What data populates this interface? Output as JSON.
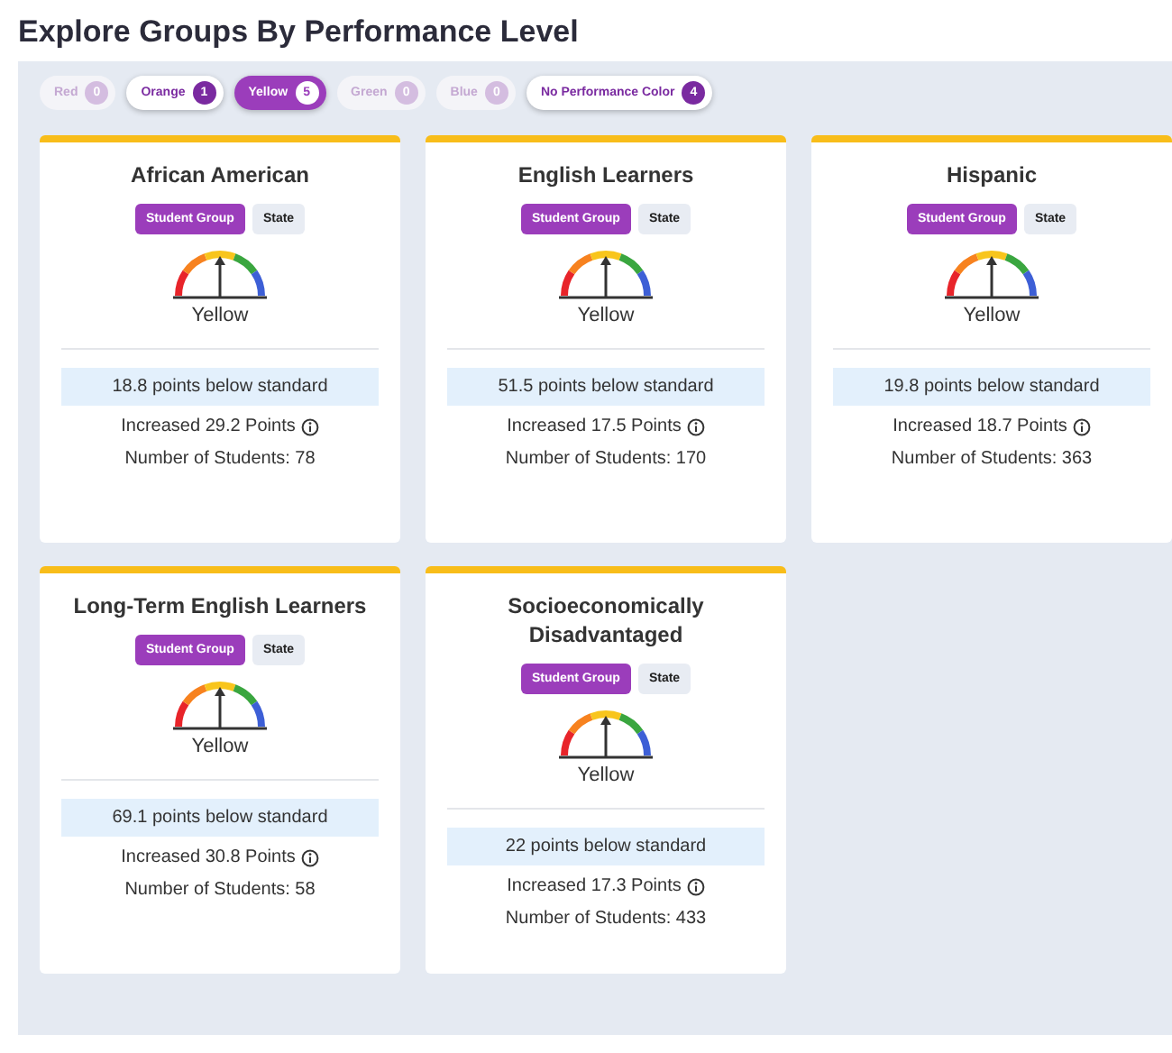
{
  "title": "Explore Groups By Performance Level",
  "filters": [
    {
      "label": "Red",
      "count": "0",
      "selected": false,
      "disabled": true
    },
    {
      "label": "Orange",
      "count": "1",
      "selected": false,
      "disabled": false
    },
    {
      "label": "Yellow",
      "count": "5",
      "selected": true,
      "disabled": false
    },
    {
      "label": "Green",
      "count": "0",
      "selected": false,
      "disabled": true
    },
    {
      "label": "Blue",
      "count": "0",
      "selected": false,
      "disabled": true
    },
    {
      "label": "No Performance Color",
      "count": "4",
      "selected": false,
      "disabled": false
    }
  ],
  "cards": [
    {
      "name": "African American",
      "tabs": [
        {
          "label": "Student Group",
          "selected": true
        },
        {
          "label": "State",
          "selected": false
        }
      ],
      "level_label": "Yellow",
      "status": "18.8 points below standard",
      "change": "Increased 29.2 Points",
      "students": "Number of Students: 78"
    },
    {
      "name": "English Learners",
      "tabs": [
        {
          "label": "Student Group",
          "selected": true
        },
        {
          "label": "State",
          "selected": false
        }
      ],
      "level_label": "Yellow",
      "status": "51.5 points below standard",
      "change": "Increased 17.5 Points",
      "students": "Number of Students: 170"
    },
    {
      "name": "Hispanic",
      "tabs": [
        {
          "label": "Student Group",
          "selected": true
        },
        {
          "label": "State",
          "selected": false
        }
      ],
      "level_label": "Yellow",
      "status": "19.8 points below standard",
      "change": "Increased 18.7 Points",
      "students": "Number of Students: 363"
    },
    {
      "name": "Long-Term English Learners",
      "tabs": [
        {
          "label": "Student Group",
          "selected": true
        },
        {
          "label": "State",
          "selected": false
        }
      ],
      "level_label": "Yellow",
      "status": "69.1 points below standard",
      "change": "Increased 30.8 Points",
      "students": "Number of Students: 58"
    },
    {
      "name": "Socioeconomically Disadvantaged",
      "tabs": [
        {
          "label": "Student Group",
          "selected": true
        },
        {
          "label": "State",
          "selected": false
        }
      ],
      "level_label": "Yellow",
      "status": "22 points below standard",
      "change": "Increased 17.3 Points",
      "students": "Number of Students: 433"
    }
  ]
}
